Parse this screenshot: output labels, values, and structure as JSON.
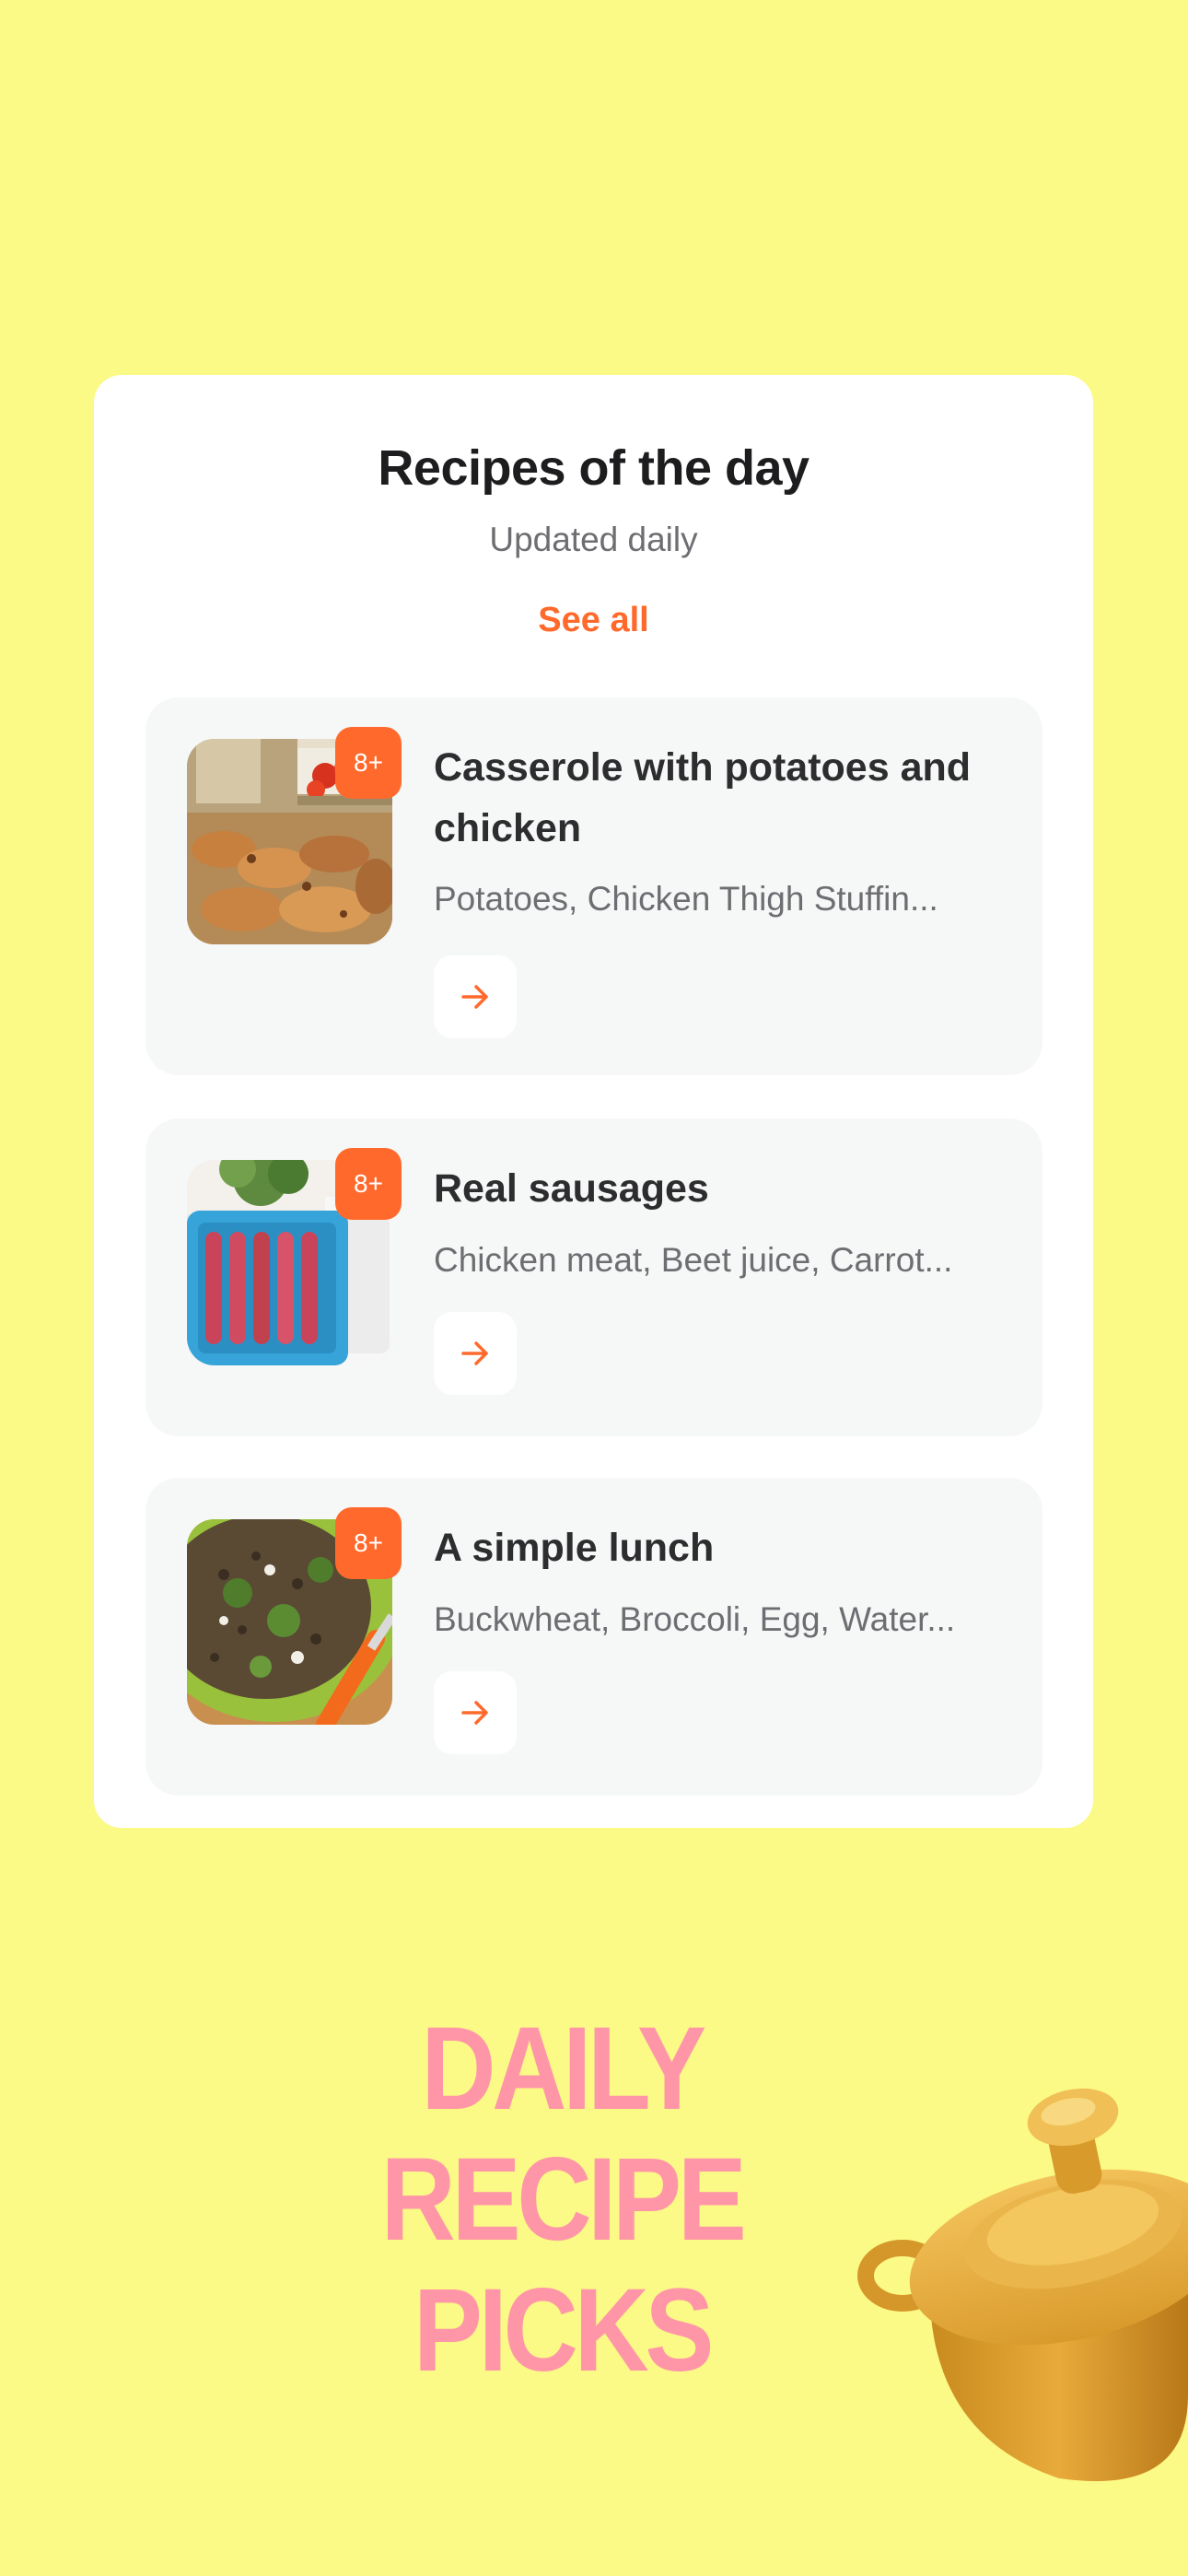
{
  "card": {
    "title": "Recipes of the day",
    "subtitle": "Updated daily",
    "see_all": "See all"
  },
  "recipes": [
    {
      "title": "Casserole with potatoes and chicken",
      "ingredients": "Potatoes, Chicken Thigh Stuffin...",
      "age_badge": "8+"
    },
    {
      "title": "Real sausages",
      "ingredients": "Chicken meat, Beet juice, Carrot...",
      "age_badge": "8+"
    },
    {
      "title": "A simple lunch",
      "ingredients": "Buckwheat, Broccoli, Egg, Water...",
      "age_badge": "8+"
    }
  ],
  "promo": {
    "line1": "DAILY",
    "line2": "RECIPE",
    "line3": "PICKS"
  },
  "colors": {
    "background": "#fbfa86",
    "accent": "#ff6a2c",
    "promo_text": "#ff96a8",
    "recipe_card": "#f6f7f7"
  },
  "icons": {
    "arrow": "arrow-right-icon",
    "pot": "cooking-pot-illustration"
  }
}
